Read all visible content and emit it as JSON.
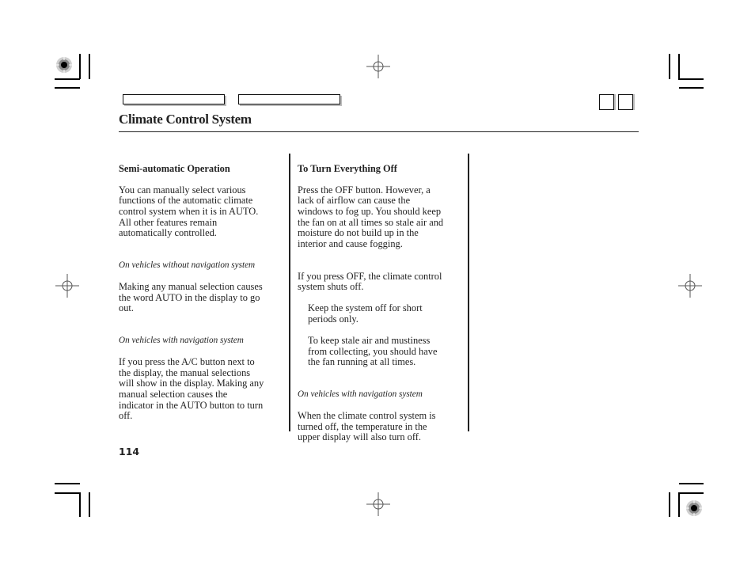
{
  "header": {
    "title": "Climate Control System",
    "nav_tabs": [
      "",
      ""
    ],
    "nav_squares": [
      "",
      ""
    ]
  },
  "columns": [
    {
      "blocks": [
        {
          "type": "heading",
          "text": "Semi-automatic Operation"
        },
        {
          "type": "para",
          "text": "You can manually select various\nfunctions of the automatic climate\ncontrol system when it is in AUTO.\nAll other features remain\nautomatically controlled."
        },
        {
          "type": "subhead",
          "text": "On vehicles without navigation system"
        },
        {
          "type": "para",
          "text": "Making any manual selection causes\nthe word AUTO in the display to go\nout."
        },
        {
          "type": "subhead",
          "text": "On vehicles with navigation system"
        },
        {
          "type": "para",
          "text": "If you press the A/C button next to\nthe display, the manual selections\nwill show in the display. Making any\nmanual selection causes the\nindicator in the AUTO button to turn\noff."
        }
      ]
    },
    {
      "blocks": [
        {
          "type": "heading",
          "text": "To Turn Everything Off"
        },
        {
          "type": "para",
          "text": "Press the OFF button. However, a\nlack of airflow can cause the\nwindows to fog up. You should keep\nthe fan on at all times so stale air and\nmoisture do not build up in the\ninterior and cause fogging."
        },
        {
          "type": "para_gap",
          "text": "If you press OFF, the climate control\nsystem shuts off."
        },
        {
          "type": "indent",
          "text": "Keep the system off for short\nperiods only."
        },
        {
          "type": "indent",
          "text": "To keep stale air and mustiness\nfrom collecting, you should have\nthe fan running at all times."
        },
        {
          "type": "subhead",
          "text": "On vehicles with navigation system"
        },
        {
          "type": "para",
          "text": "When the climate control system is\nturned off, the temperature in the\nupper display will also turn off."
        }
      ]
    }
  ],
  "footer": {
    "page_number": "114"
  },
  "print_marks": {
    "registration_icon": "crosshair-target-icon",
    "color_bar_icon": "printer-dot-icon"
  }
}
